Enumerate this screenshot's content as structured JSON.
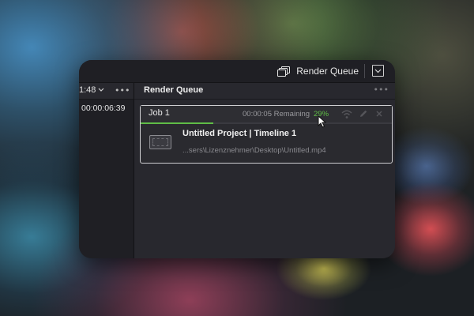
{
  "toolbar": {
    "render_queue_label": "Render Queue",
    "icons": {
      "render_queue": "render-queue-icon",
      "window_menu": "chevron-down-icon"
    }
  },
  "left_panel": {
    "timecode_top": "1:48",
    "timecode_second": "00:00:06:39",
    "options": "•••"
  },
  "render_queue": {
    "title": "Render Queue",
    "options": "•••",
    "jobs": [
      {
        "name": "Job 1",
        "remaining": "00:00:05 Remaining",
        "percent_label": "29%",
        "progress": 0.29,
        "project": "Untitled Project | Timeline 1",
        "path": "...sers\\Lizenznehmer\\Desktop\\Untitled.mp4"
      }
    ]
  },
  "colors": {
    "accent_green": "#5fbd46",
    "panel_bg": "#28282e",
    "toolbar_bg": "#1f1f24"
  }
}
